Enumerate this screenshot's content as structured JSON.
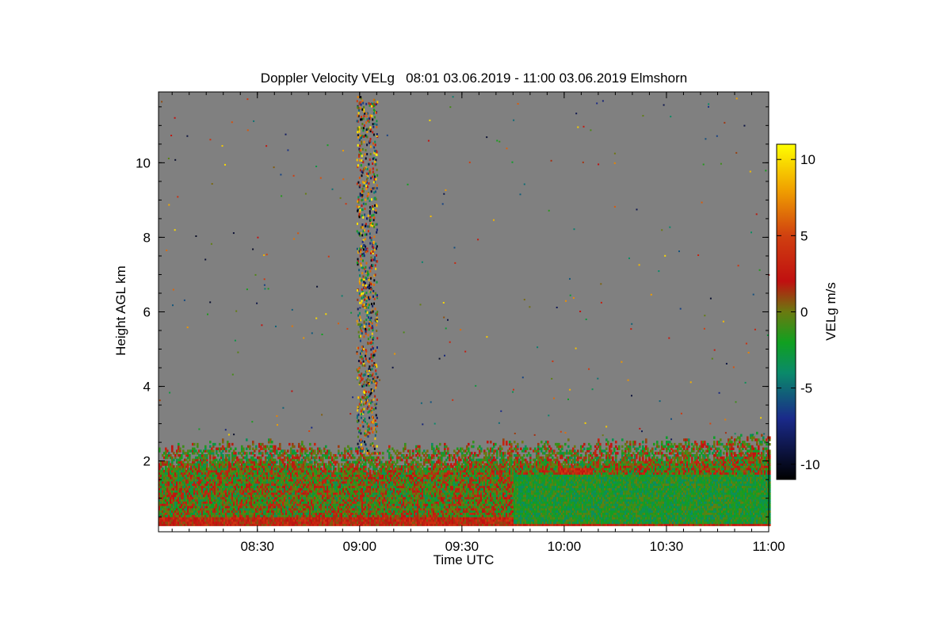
{
  "chart_data": {
    "type": "heatmap",
    "title": "Doppler Velocity VELg   08:01 03.06.2019 - 11:00 03.06.2019 Elmshorn",
    "xlabel": "Time UTC",
    "ylabel": "Height AGL km",
    "colorbar_label": "VELg m/s",
    "x_range_minutes": [
      481,
      660
    ],
    "y_range_km": [
      0.1,
      11.9
    ],
    "x_ticks": [
      {
        "value": 510,
        "label": "08:30"
      },
      {
        "value": 540,
        "label": "09:00"
      },
      {
        "value": 570,
        "label": "09:30"
      },
      {
        "value": 600,
        "label": "10:00"
      },
      {
        "value": 630,
        "label": "10:30"
      },
      {
        "value": 660,
        "label": "11:00"
      }
    ],
    "y_ticks": [
      {
        "value": 2,
        "label": "2"
      },
      {
        "value": 4,
        "label": "4"
      },
      {
        "value": 6,
        "label": "6"
      },
      {
        "value": 8,
        "label": "8"
      },
      {
        "value": 10,
        "label": "10"
      }
    ],
    "colorbar_range": [
      -11,
      11
    ],
    "colorbar_ticks": [
      {
        "value": 10,
        "label": "10"
      },
      {
        "value": 5,
        "label": "5"
      },
      {
        "value": 0,
        "label": "0"
      },
      {
        "value": -5,
        "label": "-5"
      },
      {
        "value": -10,
        "label": "-10"
      }
    ],
    "colorscale": [
      {
        "value": -11,
        "color": "#000000"
      },
      {
        "value": -7,
        "color": "#1a2a8a"
      },
      {
        "value": -4,
        "color": "#0a8a6a"
      },
      {
        "value": -2,
        "color": "#10a020"
      },
      {
        "value": 0,
        "color": "#6a7a10"
      },
      {
        "value": 2,
        "color": "#c01010"
      },
      {
        "value": 5,
        "color": "#d04010"
      },
      {
        "value": 8,
        "color": "#f0a000"
      },
      {
        "value": 11,
        "color": "#ffff00"
      }
    ],
    "background_color": "#808080",
    "no_data_band_km": [
      0.0,
      0.25
    ],
    "boundary_layer_top_km": [
      {
        "t": 481,
        "h": 2.3
      },
      {
        "t": 500,
        "h": 2.4
      },
      {
        "t": 520,
        "h": 2.4
      },
      {
        "t": 540,
        "h": 2.2
      },
      {
        "t": 560,
        "h": 2.3
      },
      {
        "t": 580,
        "h": 2.4
      },
      {
        "t": 600,
        "h": 2.4
      },
      {
        "t": 620,
        "h": 2.45
      },
      {
        "t": 640,
        "h": 2.5
      },
      {
        "t": 660,
        "h": 2.6
      }
    ],
    "noise_column_minutes": [
      539,
      545
    ],
    "dominant_velocity_regions": [
      {
        "name": "strong updraft near ground",
        "t": [
          481,
          660
        ],
        "h": [
          0.25,
          0.45
        ],
        "value": 2.5
      },
      {
        "name": "red patch",
        "t": [
          598,
          608
        ],
        "h": [
          1.0,
          1.8
        ],
        "value": 3
      },
      {
        "name": "red patch",
        "t": [
          602,
          616
        ],
        "h": [
          0.35,
          0.9
        ],
        "value": 3
      },
      {
        "name": "green downdraft region",
        "t": [
          585,
          660
        ],
        "h": [
          0.3,
          1.6
        ],
        "value": -2
      }
    ]
  }
}
